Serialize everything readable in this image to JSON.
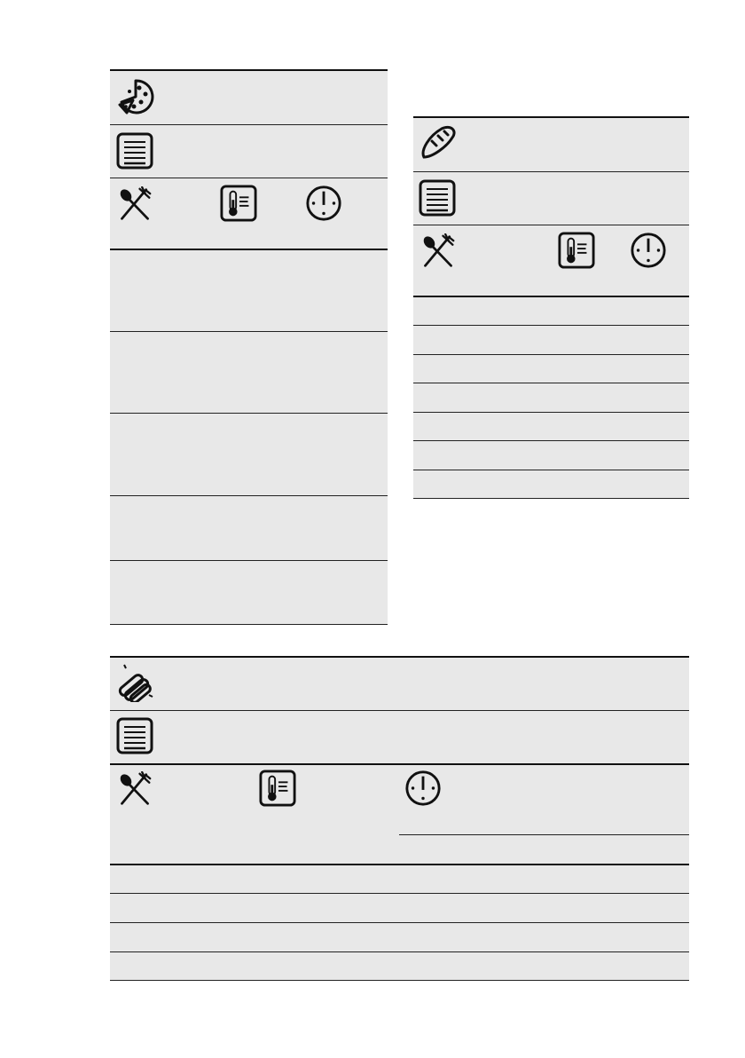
{
  "colors": {
    "shading": "#e8e8e8",
    "rule": "#111111"
  },
  "table_a": {
    "category_icon": "pizza-icon",
    "accessory_icon": "baking-tray-icon",
    "header_icons": [
      "food-icon",
      "food-sensor-thermometer-icon",
      "timer-icon"
    ],
    "rows": 5
  },
  "table_b": {
    "category_icon": "bread-icon",
    "accessory_icon": "baking-tray-icon",
    "header_icons": [
      "food-icon",
      "food-sensor-thermometer-icon",
      "timer-icon"
    ],
    "rows": 7
  },
  "table_c": {
    "category_icon": "sausages-icon",
    "accessory_icon": "baking-tray-icon",
    "header_icons": [
      "food-icon",
      "food-sensor-thermometer-icon",
      "timer-icon"
    ],
    "rows": 4
  }
}
